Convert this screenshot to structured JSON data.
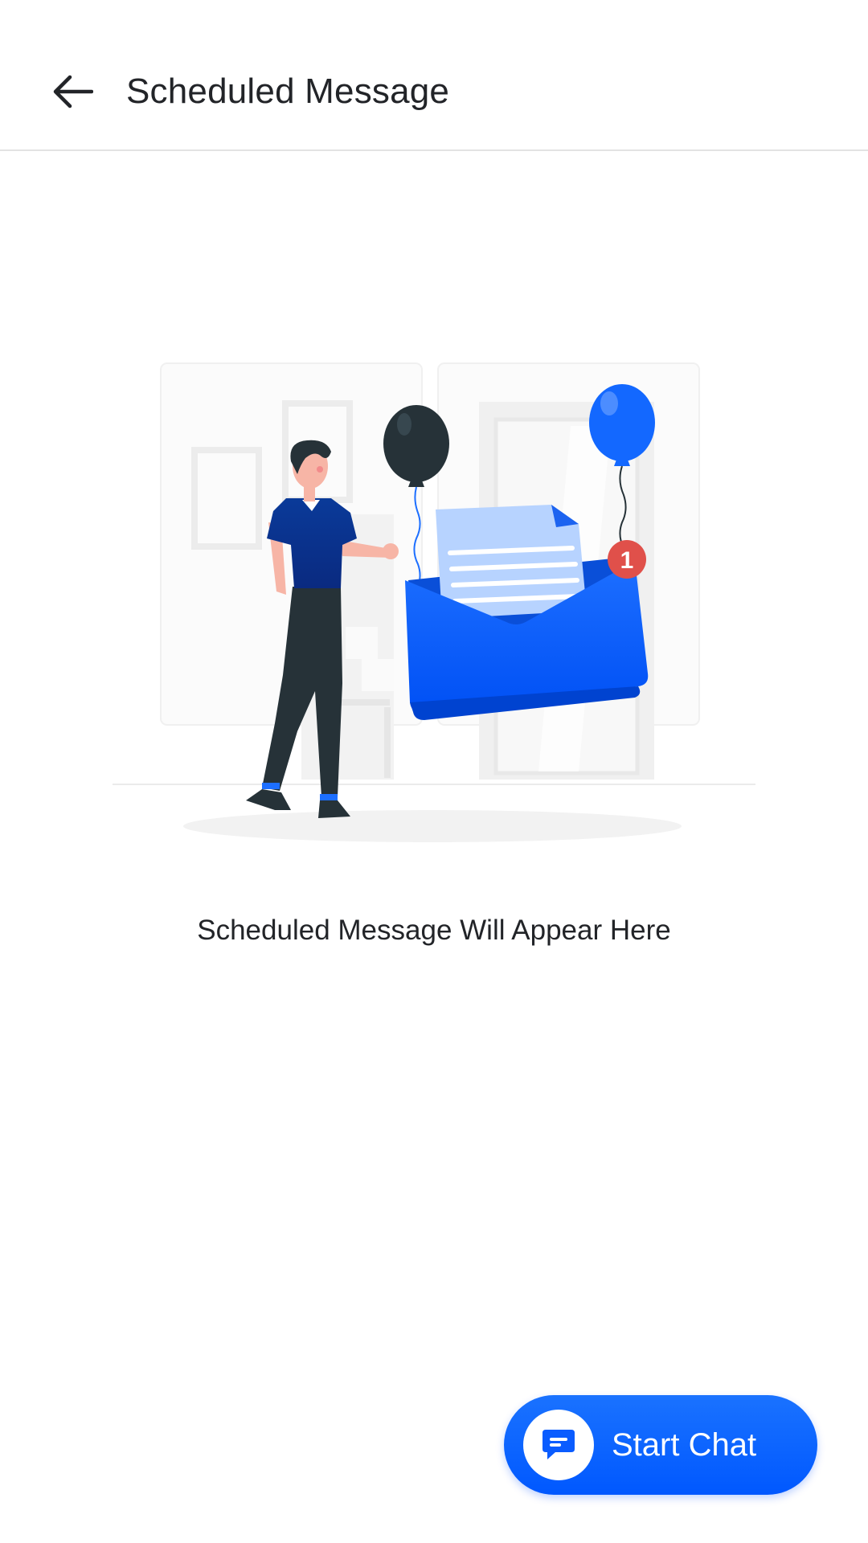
{
  "header": {
    "title": "Scheduled Message",
    "back_icon": "arrow-left-icon"
  },
  "empty_state": {
    "illustration": "envelope-with-balloons-illustration",
    "message": "Scheduled Message Will Appear Here",
    "badge_count": "1"
  },
  "fab": {
    "label": "Start Chat",
    "icon": "chat-bubble-icon"
  },
  "colors": {
    "accent": "#0A5CFF",
    "text": "#222428",
    "divider": "#E3E3E3",
    "badge": "#E0504A"
  }
}
